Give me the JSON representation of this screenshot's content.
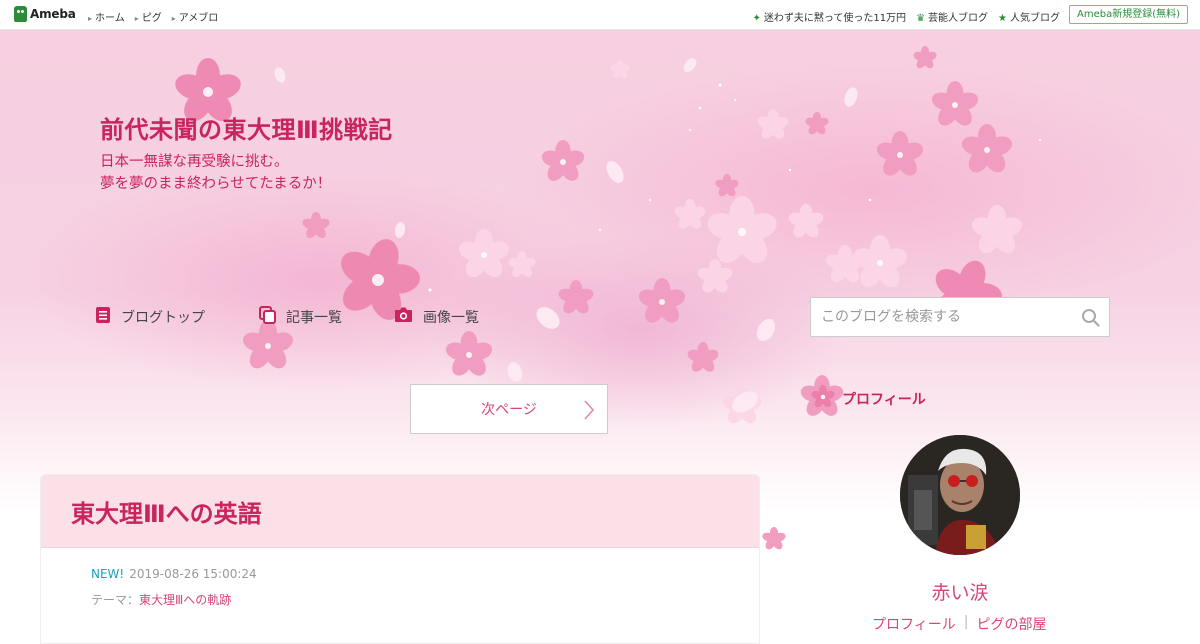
{
  "topbar": {
    "logo": "Ameba",
    "nav": [
      "ホーム",
      "ピグ",
      "アメブロ"
    ],
    "right_links": [
      {
        "icon": "sparkle-icon",
        "label": "迷わず夫に黙って使った11万円"
      },
      {
        "icon": "crown-icon",
        "label": "芸能人ブログ"
      },
      {
        "icon": "star-icon",
        "label": "人気ブログ"
      }
    ],
    "register": "Ameba新規登録(無料)"
  },
  "header": {
    "title": "前代未聞の東大理Ⅲ挑戦記",
    "description_line1": "日本一無謀な再受験に挑む。",
    "description_line2": "夢を夢のまま終わらせてたまるか！"
  },
  "nav": {
    "blog_top": "ブログトップ",
    "articles": "記事一覧",
    "images": "画像一覧"
  },
  "search": {
    "placeholder": "このブログを検索する"
  },
  "pager": {
    "next": "次ページ"
  },
  "article": {
    "title": "東大理Ⅲへの英語",
    "badge": "NEW!",
    "date": "2019-08-26 15:00:24",
    "theme_label": "テーマ：",
    "theme": "東大理Ⅲへの軌跡"
  },
  "profile": {
    "heading": "プロフィール",
    "name": "赤い涙",
    "links": [
      "プロフィール",
      "ピグの部屋"
    ],
    "separator": "|"
  },
  "colors": {
    "accent": "#c9245e",
    "link": "#d6467a",
    "brand_green": "#2d8c3c",
    "header_bg": "#f7cfe0"
  }
}
